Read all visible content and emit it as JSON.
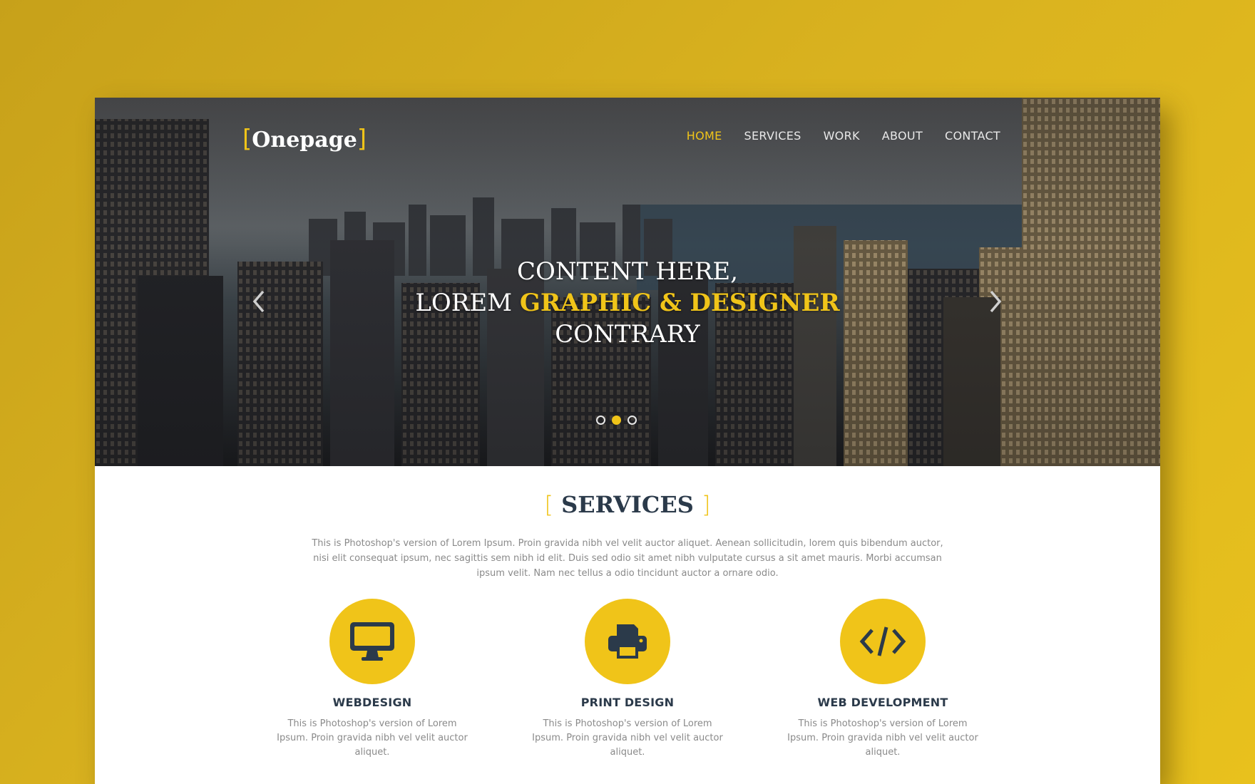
{
  "logo": {
    "bracket_open": "[",
    "text": "Onepage",
    "bracket_close": "]"
  },
  "nav": {
    "items": [
      {
        "label": "HOME",
        "active": true
      },
      {
        "label": "SERVICES",
        "active": false
      },
      {
        "label": "WORK",
        "active": false
      },
      {
        "label": "ABOUT",
        "active": false
      },
      {
        "label": "CONTACT",
        "active": false
      }
    ]
  },
  "hero": {
    "line1": "CONTENT HERE,",
    "line2_plain": "LOREM ",
    "line2_highlight": "GRAPHIC & DESIGNER",
    "line3": "CONTRARY",
    "slides_total": 3,
    "active_slide": 2,
    "prev_icon": "chevron-left-icon",
    "next_icon": "chevron-right-icon"
  },
  "services": {
    "bracket_open": "[",
    "title": "SERVICES",
    "bracket_close": "]",
    "intro": "This is Photoshop's version of Lorem Ipsum. Proin gravida nibh vel velit auctor aliquet. Aenean sollicitudin, lorem quis bibendum auctor, nisi elit consequat ipsum, nec sagittis sem nibh id elit. Duis sed odio sit amet nibh vulputate cursus a sit amet mauris. Morbi accumsan ipsum velit. Nam nec tellus a odio tincidunt auctor a ornare odio.",
    "items": [
      {
        "icon": "monitor-icon",
        "title": "WEBDESIGN",
        "text": "This is Photoshop's version of Lorem Ipsum. Proin gravida nibh vel velit auctor aliquet."
      },
      {
        "icon": "printer-icon",
        "title": "PRINT DESIGN",
        "text": "This is Photoshop's version of Lorem Ipsum. Proin gravida nibh vel velit auctor aliquet."
      },
      {
        "icon": "code-icon",
        "title": "WEB DEVELOPMENT",
        "text": "This is Photoshop's version of Lorem Ipsum. Proin gravida nibh vel velit auctor aliquet."
      }
    ]
  },
  "colors": {
    "accent": "#f0c419",
    "background": "#d9b21f",
    "heading": "#2b3a4a",
    "body_text": "#8a8a8a"
  }
}
